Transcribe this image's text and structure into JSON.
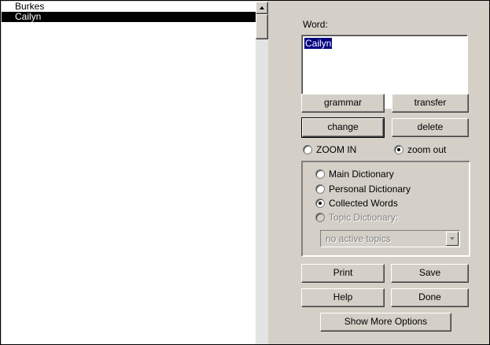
{
  "word_list": {
    "items": [
      {
        "label": "Burkes",
        "selected": false
      },
      {
        "label": "Cailyn",
        "selected": true
      }
    ]
  },
  "word_panel": {
    "label": "Word:",
    "value": "Cailyn"
  },
  "buttons": {
    "grammar": "grammar",
    "transfer": "transfer",
    "change": "change",
    "delete": "delete",
    "print": "Print",
    "save": "Save",
    "help": "Help",
    "done": "Done",
    "more_options": "Show More Options"
  },
  "zoom": {
    "zoom_in": "ZOOM IN",
    "zoom_out": "zoom out",
    "selected": "zoom_out"
  },
  "dictionary": {
    "options": [
      {
        "label": "Main Dictionary",
        "checked": false,
        "disabled": false
      },
      {
        "label": "Personal Dictionary",
        "checked": false,
        "disabled": false
      },
      {
        "label": "Collected Words",
        "checked": true,
        "disabled": false
      },
      {
        "label": "Topic Dictionary:",
        "checked": false,
        "disabled": true
      }
    ],
    "topic_select": {
      "value": "no active topics",
      "disabled": true
    }
  },
  "colors": {
    "panel_bg": "#d4d0c8",
    "selection_bg": "#000000",
    "text_highlight": "#000080"
  }
}
